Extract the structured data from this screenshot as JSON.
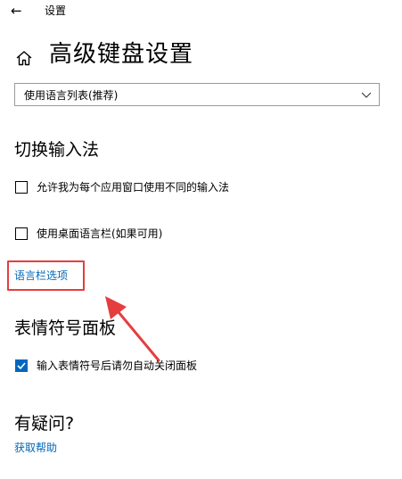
{
  "window": {
    "title": "设置"
  },
  "page": {
    "title": "高级键盘设置"
  },
  "language_dropdown": {
    "selected": "使用语言列表(推荐)"
  },
  "switch_input": {
    "heading": "切换输入法",
    "per_app_label": "允许我为每个应用窗口使用不同的输入法",
    "per_app_checked": false,
    "desktop_bar_label": "使用桌面语言栏(如果可用)",
    "desktop_bar_checked": false,
    "language_bar_options_link": "语言栏选项"
  },
  "emoji_panel": {
    "heading": "表情符号面板",
    "auto_close_label": "输入表情符号后请勿自动关闭面板",
    "auto_close_checked": true
  },
  "help": {
    "heading": "有疑问?",
    "get_help_link": "获取帮助"
  },
  "annotation": {
    "highlight_color": "#e53e3e"
  },
  "colors": {
    "accent": "#0067c0",
    "link": "#0067b8"
  },
  "icons": {
    "back": "back-arrow-icon",
    "home": "home-icon",
    "dropdown": "chevron-down-icon",
    "check": "checkmark-icon"
  }
}
